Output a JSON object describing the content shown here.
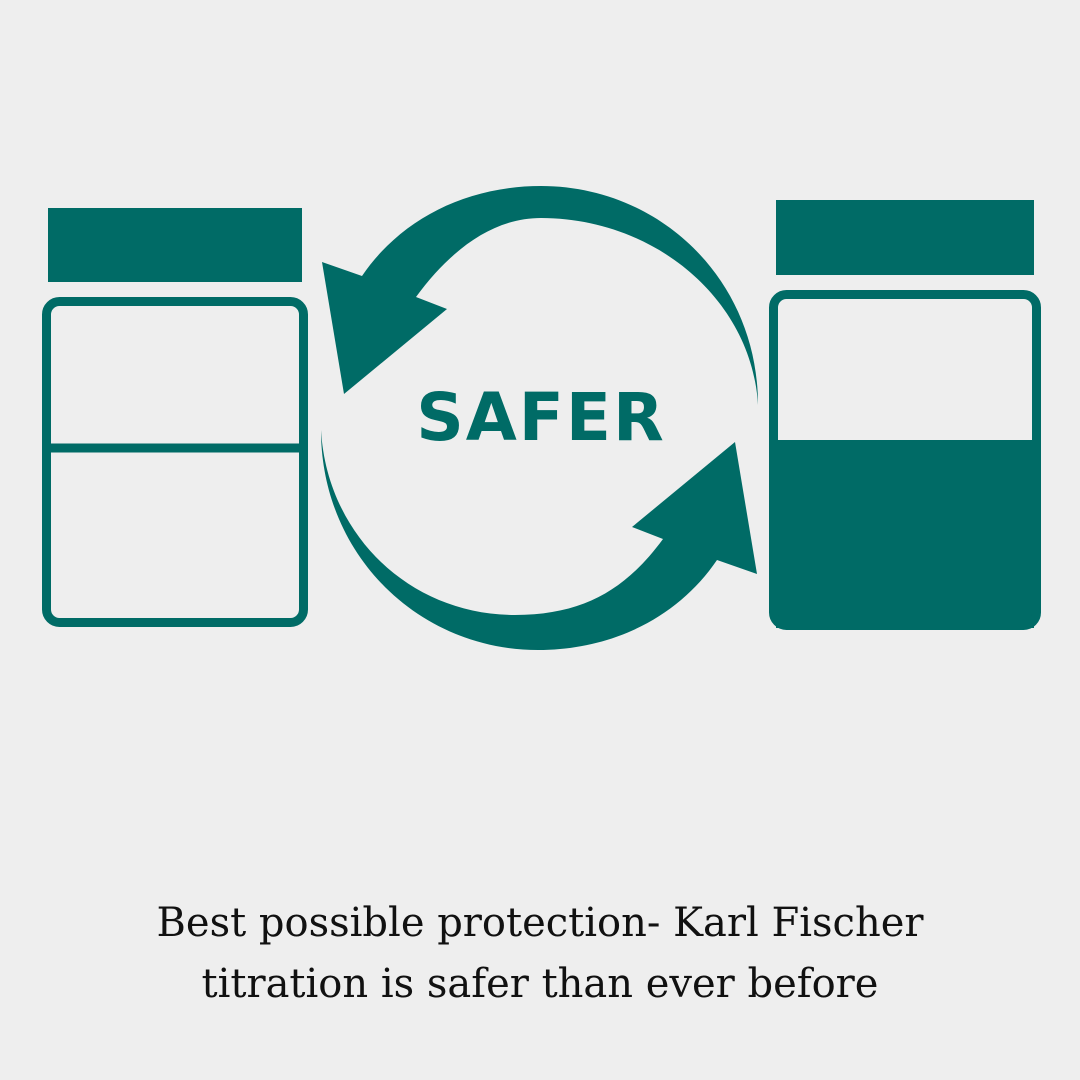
{
  "diagram": {
    "center_word": "SAFER",
    "colors": {
      "accent": "#006b66",
      "background": "#eeeeee",
      "text": "#111111"
    },
    "left_jar": {
      "icon": "empty-jar-icon"
    },
    "right_jar": {
      "icon": "full-jar-icon"
    },
    "arrows": [
      "curved-arrow-left-icon",
      "curved-arrow-right-icon"
    ]
  },
  "caption": {
    "line1": "Best possible protection- Karl Fischer",
    "line2": "titration is safer than ever before"
  }
}
